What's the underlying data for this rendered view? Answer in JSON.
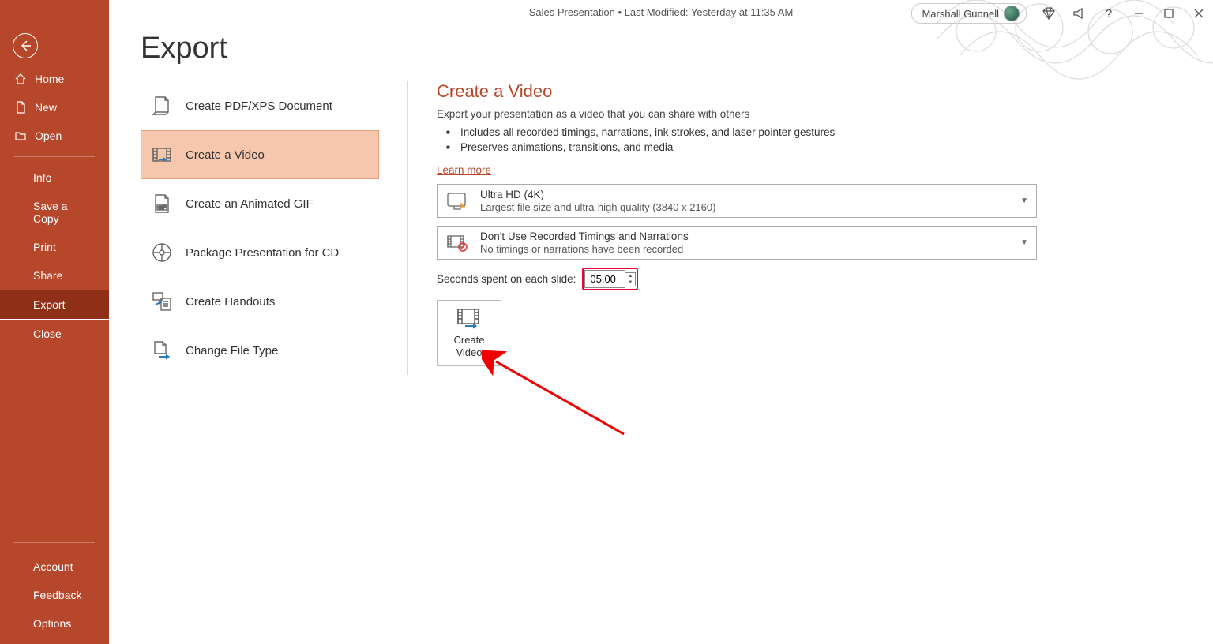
{
  "title": "Sales Presentation • Last Modified: Yesterday at 11:35 AM",
  "user": "Marshall Gunnell",
  "page_title": "Export",
  "sidebar": {
    "home": "Home",
    "new": "New",
    "open": "Open",
    "info": "Info",
    "save_copy": "Save a Copy",
    "print": "Print",
    "share": "Share",
    "export": "Export",
    "close": "Close",
    "account": "Account",
    "feedback": "Feedback",
    "options": "Options"
  },
  "export_items": {
    "pdf": "Create PDF/XPS Document",
    "video": "Create a Video",
    "gif": "Create an Animated GIF",
    "cd": "Package Presentation for CD",
    "handouts": "Create Handouts",
    "filetype": "Change File Type"
  },
  "detail": {
    "heading": "Create a Video",
    "sub": "Export your presentation as a video that you can share with others",
    "b1": "Includes all recorded timings, narrations, ink strokes, and laser pointer gestures",
    "b2": "Preserves animations, transitions, and media",
    "learn": "Learn more",
    "quality_t": "Ultra HD (4K)",
    "quality_d": "Largest file size and ultra-high quality (3840 x 2160)",
    "timing_t": "Don't Use Recorded Timings and Narrations",
    "timing_d": "No timings or narrations have been recorded",
    "seconds_label": "Seconds spent on each slide:",
    "seconds_value": "05.00",
    "create_label": "Create\nVideo"
  }
}
